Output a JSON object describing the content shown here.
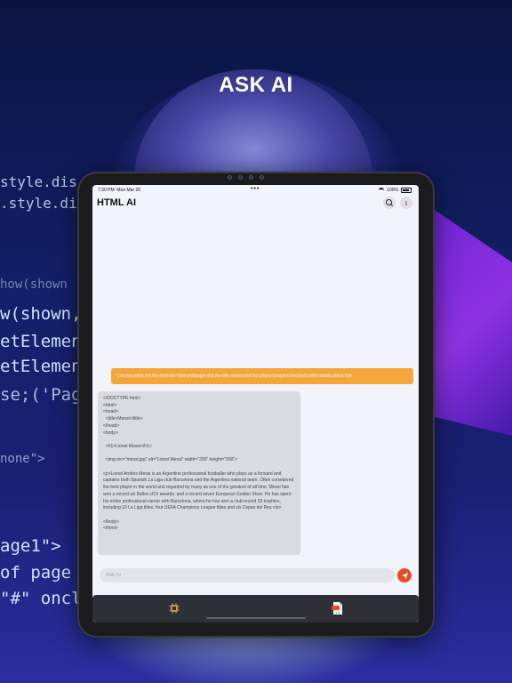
{
  "headline": "ASK AI",
  "background_code_lines": [
    "style.dis",
    ".style.di",
    "how(shown",
    "w(shown,",
    "etElemen",
    "etElemen",
    "se;('Pag",
    "none\">",
    "age1\">",
    "of page",
    "\"#\" oncl"
  ],
  "status_bar": {
    "time": "7:30 PM",
    "date": "Mon Mar 20",
    "battery": "100%"
  },
  "app": {
    "title": "HTML AI",
    "icons": {
      "search": "search-icon",
      "info": "info-icon"
    }
  },
  "chat": {
    "user_message": "Can you write me the code for html webpage with the title messi and the player image in the body with details about him",
    "ai_response_lines": [
      "<!DOCTYPE html>",
      "<html>",
      "<head>",
      "  <title>Messi</title>",
      "</head>",
      "<body>",
      "",
      "  <h1>Lionel Messi</h1>",
      "",
      "  <img src=\"messi.jpg\" alt=\"Lionel Messi\" width=\"200\" height=\"200\">",
      "",
      "  <p>Lionel Andres Messi is an Argentine professional footballer who plays as a forward and captains both Spanish La Liga club Barcelona and the Argentina national team. Often considered the best player in the world and regarded by many as one of the greatest of all time, Messi has won a record six Ballon d'Or awards, and a record seven European Golden Shoe. He has spent his entire professional career with Barcelona, where he has won a club-record 33 trophies, including 10 La Liga titles, four UEFA Champions League titles and six Copas del Rey.</p>",
      "",
      "</body>",
      "</html>"
    ]
  },
  "composer": {
    "placeholder": "Ask AI",
    "send_icon": "send-icon"
  },
  "tab_bar": {
    "items": [
      {
        "icon": "chip-icon"
      },
      {
        "icon": "html-file-icon"
      }
    ]
  },
  "colors": {
    "accent": "#f5a53a",
    "send": "#e84d1f",
    "tab_bar": "#2d3036",
    "background": "#14206a"
  }
}
